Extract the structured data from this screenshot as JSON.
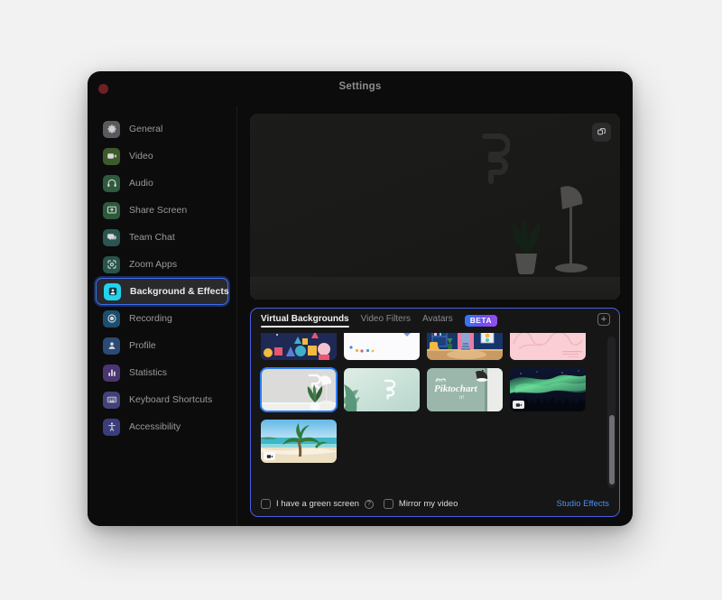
{
  "window": {
    "title": "Settings",
    "close_label": "Close"
  },
  "sidebar": {
    "items": [
      {
        "label": "General",
        "icon": "gear-icon",
        "icon_bg": "#5a5a5e",
        "selected": false
      },
      {
        "label": "Video",
        "icon": "video-camera-icon",
        "icon_bg": "#3e5a2c",
        "selected": false
      },
      {
        "label": "Audio",
        "icon": "headphones-icon",
        "icon_bg": "#2f5a3c",
        "selected": false
      },
      {
        "label": "Share Screen",
        "icon": "share-screen-icon",
        "icon_bg": "#2c5a3a",
        "selected": false
      },
      {
        "label": "Team Chat",
        "icon": "chat-bubble-icon",
        "icon_bg": "#2a5550",
        "selected": false
      },
      {
        "label": "Zoom Apps",
        "icon": "zoom-apps-icon",
        "icon_bg": "#27544b",
        "selected": false
      },
      {
        "label": "Background & Effects",
        "icon": "background-person-icon",
        "icon_bg": "#22d3ee",
        "selected": true
      },
      {
        "label": "Recording",
        "icon": "record-circle-icon",
        "icon_bg": "#1d4e6e",
        "selected": false
      },
      {
        "label": "Profile",
        "icon": "person-icon",
        "icon_bg": "#2b4a75",
        "selected": false
      },
      {
        "label": "Statistics",
        "icon": "bar-chart-icon",
        "icon_bg": "#4a3570",
        "selected": false
      },
      {
        "label": "Keyboard Shortcuts",
        "icon": "keyboard-icon",
        "icon_bg": "#43407a",
        "selected": false
      },
      {
        "label": "Accessibility",
        "icon": "accessibility-icon",
        "icon_bg": "#3b3d7a",
        "selected": false
      }
    ]
  },
  "preview": {
    "action_icon": "duplicate-icon",
    "scene_description": "Dimmed room with wall logo, potted plant and desk lamp"
  },
  "bg_panel": {
    "tabs": [
      {
        "label": "Virtual Backgrounds",
        "active": true
      },
      {
        "label": "Video Filters",
        "active": false
      },
      {
        "label": "Avatars",
        "active": false
      }
    ],
    "beta_badge": "BETA",
    "add_button_label": "+",
    "thumbnails": [
      {
        "name": "confetti-shapes-background",
        "style": "confetti",
        "selected": false,
        "video": false
      },
      {
        "name": "white-blank-background",
        "style": "white",
        "selected": false,
        "video": false
      },
      {
        "name": "blue-room-background",
        "style": "blueroom",
        "selected": false,
        "video": false
      },
      {
        "name": "pink-squiggle-background",
        "style": "pink",
        "selected": false,
        "video": false
      },
      {
        "name": "grey-wall-plant-background",
        "style": "greywall",
        "selected": true,
        "video": false
      },
      {
        "name": "mint-palm-background",
        "style": "mint",
        "selected": false,
        "video": false
      },
      {
        "name": "piktochart-wall-background",
        "style": "pikto",
        "selected": false,
        "video": false
      },
      {
        "name": "aurora-forest-background",
        "style": "aurora",
        "selected": false,
        "video": true
      },
      {
        "name": "tropical-beach-background",
        "style": "beach",
        "selected": false,
        "video": true
      }
    ],
    "footer": {
      "green_screen_label": "I have a green screen",
      "green_screen_checked": false,
      "help_icon": "question-mark-icon",
      "mirror_label": "Mirror my video",
      "mirror_checked": false,
      "studio_effects_label": "Studio Effects"
    }
  },
  "colors": {
    "accent_blue": "#2f7cf6",
    "panel_border": "#4a5fe0",
    "link_blue": "#4a8ff0",
    "selected_icon": "#22d3ee"
  }
}
